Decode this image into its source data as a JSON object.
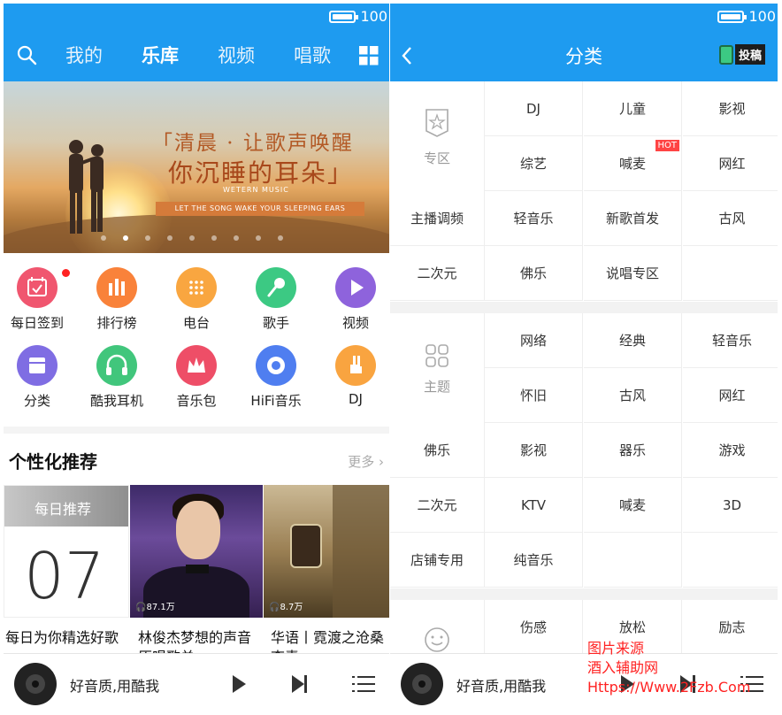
{
  "status": {
    "battery": "100"
  },
  "left": {
    "tabs": [
      "我的",
      "乐库",
      "视频",
      "唱歌"
    ],
    "active_tab": "乐库",
    "banner": {
      "line1": "「清晨 · 让歌声唤醒",
      "line2": "你沉睡的耳朵」",
      "line3": "WETERN MUSIC",
      "line4": "LET THE SONG WAKE YOUR SLEEPING EARS"
    },
    "icons": [
      {
        "label": "每日签到",
        "color": "#f0566f"
      },
      {
        "label": "排行榜",
        "color": "#f9823a"
      },
      {
        "label": "电台",
        "color": "#f9a640"
      },
      {
        "label": "歌手",
        "color": "#3cc983"
      },
      {
        "label": "视频",
        "color": "#8e63dc"
      },
      {
        "label": "分类",
        "color": "#7f6de3"
      },
      {
        "label": "酷我耳机",
        "color": "#41c67c"
      },
      {
        "label": "音乐包",
        "color": "#ee4e67"
      },
      {
        "label": "HiFi音乐",
        "color": "#4f7ef0"
      },
      {
        "label": "DJ",
        "color": "#f9a440"
      }
    ],
    "rec": {
      "title": "个性化推荐",
      "more": "更多 ›",
      "daily_label": "每日推荐",
      "daily_num": "07",
      "cards": [
        {
          "caption": "每日为你精选好歌",
          "count": ""
        },
        {
          "caption": "林俊杰梦想的声音原唱歌单",
          "count": "87.1万"
        },
        {
          "caption": "华语丨霓渡之沧桑李靑",
          "count": "8.7万"
        }
      ]
    }
  },
  "right": {
    "title": "分类",
    "upload": "投稿",
    "sections": [
      {
        "name": "专区",
        "cells": [
          "DJ",
          "儿童",
          "影视",
          "综艺",
          "喊麦",
          "网红",
          "主播调频",
          "轻音乐",
          "新歌首发",
          "古风",
          "二次元",
          "佛乐",
          "说唱专区",
          ""
        ]
      },
      {
        "name": "主题",
        "cells": [
          "网络",
          "经典",
          "轻音乐",
          "怀旧",
          "古风",
          "网红",
          "佛乐",
          "影视",
          "器乐",
          "游戏",
          "二次元",
          "KTV",
          "喊麦",
          "3D",
          "店铺专用",
          "纯音乐",
          "",
          ""
        ]
      },
      {
        "name": "",
        "cells": [
          "伤感",
          "放松",
          "励志"
        ]
      }
    ],
    "hot_badge": "HOT"
  },
  "player": {
    "text": "好音质,用酷我"
  },
  "watermark": [
    "图片来源",
    "酒入辅助网",
    "Https://Www.2Fzb.Com"
  ]
}
